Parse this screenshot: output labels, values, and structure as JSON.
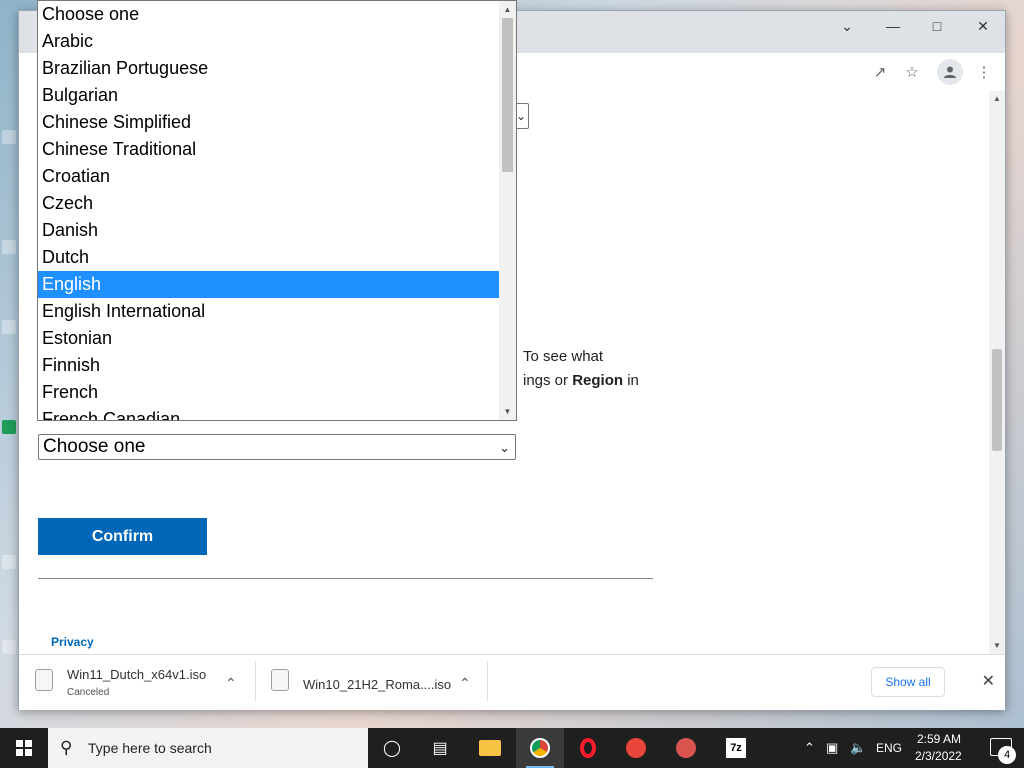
{
  "page": {
    "text_line1": "To see what",
    "text_line2_part1": "ings or ",
    "text_line2_bold": "Region",
    "text_line2_part2": " in",
    "language_select_value": "Choose one",
    "confirm_label": "Confirm",
    "privacy_link": "Privacy"
  },
  "dropdown": {
    "options": [
      "Choose one",
      "Arabic",
      "Brazilian Portuguese",
      "Bulgarian",
      "Chinese Simplified",
      "Chinese Traditional",
      "Croatian",
      "Czech",
      "Danish",
      "Dutch",
      "English",
      "English International",
      "Estonian",
      "Finnish",
      "French",
      "French Canadian"
    ],
    "highlighted": "English"
  },
  "downloads": {
    "items": [
      {
        "name": "Win11_Dutch_x64v1.iso",
        "status": "Canceled"
      },
      {
        "name": "Win10_21H2_Roma....iso",
        "status": ""
      }
    ],
    "show_all": "Show all"
  },
  "taskbar": {
    "search_placeholder": "Type here to search",
    "language": "ENG",
    "time": "2:59 AM",
    "date": "2/3/2022",
    "notification_count": "4"
  },
  "colors": {
    "accent": "#0067b8",
    "selection": "#1e90ff"
  }
}
